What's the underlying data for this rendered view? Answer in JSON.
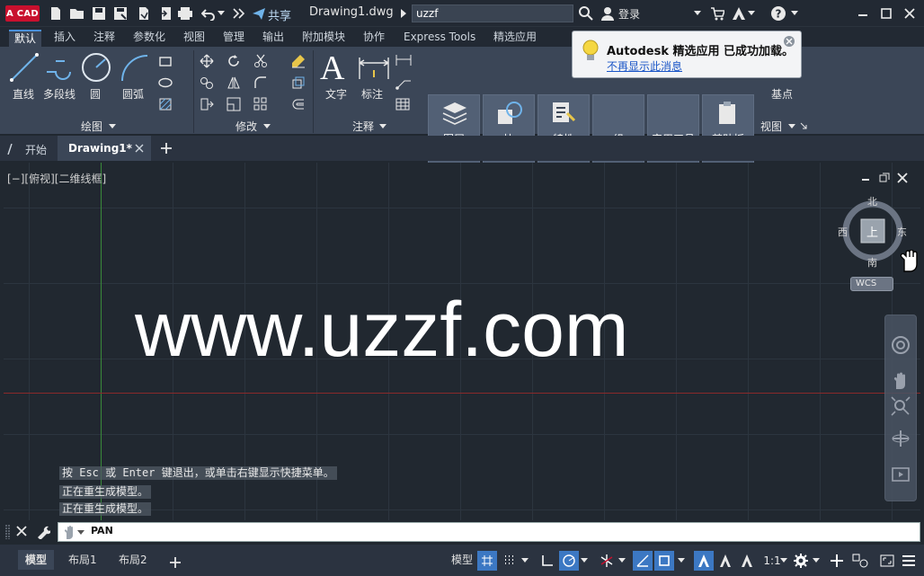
{
  "app": {
    "logo_label": "A CAD",
    "share_label": "共享",
    "doc_title": "Drawing1.dwg",
    "search_value": "uzzf",
    "login_label": "登录"
  },
  "ribbon_tabs": [
    "默认",
    "插入",
    "注释",
    "参数化",
    "视图",
    "管理",
    "输出",
    "附加模块",
    "协作",
    "Express Tools",
    "精选应用"
  ],
  "ribbon": {
    "draw_tools": {
      "line": "直线",
      "polyline": "多段线",
      "circle": "圆",
      "arc": "圆弧"
    },
    "draw_group": "绘图",
    "modify_group": "修改",
    "annot_tools": {
      "text": "文字",
      "dimension": "标注"
    },
    "annot_group": "注释",
    "panels": {
      "layers": "图层",
      "block": "块",
      "properties": "特性",
      "group": "组",
      "utilities": "实用工具",
      "clipboard": "剪贴板",
      "basepoint": "基点",
      "view_group": "视图"
    }
  },
  "popup": {
    "title": "Autodesk 精选应用 已成功加载。",
    "link": "不再显示此消息"
  },
  "doc_tabs": {
    "start": "开始",
    "drawing": "Drawing1*"
  },
  "viewport": {
    "controls": "[−][俯视][二维线框]",
    "watermark": "www.uzzf.com"
  },
  "viewcube": {
    "north": "北",
    "south": "南",
    "east": "东",
    "west": "西",
    "top": "上",
    "wcs": "WCS"
  },
  "command": {
    "messages": [
      "按 Esc 或 Enter 键退出，或单击右键显示快捷菜单。",
      "正在重生成模型。",
      "正在重生成模型。"
    ],
    "current": "PAN"
  },
  "layout_tabs": {
    "model": "模型",
    "layout1": "布局1",
    "layout2": "布局2"
  },
  "status": {
    "model": "模型",
    "scale": "1:1"
  },
  "colors": {
    "accent": "#4a90d9",
    "x_axis": "#8a2a2a",
    "y_axis": "#3a8a3a",
    "autocad_red": "#c8102e"
  }
}
